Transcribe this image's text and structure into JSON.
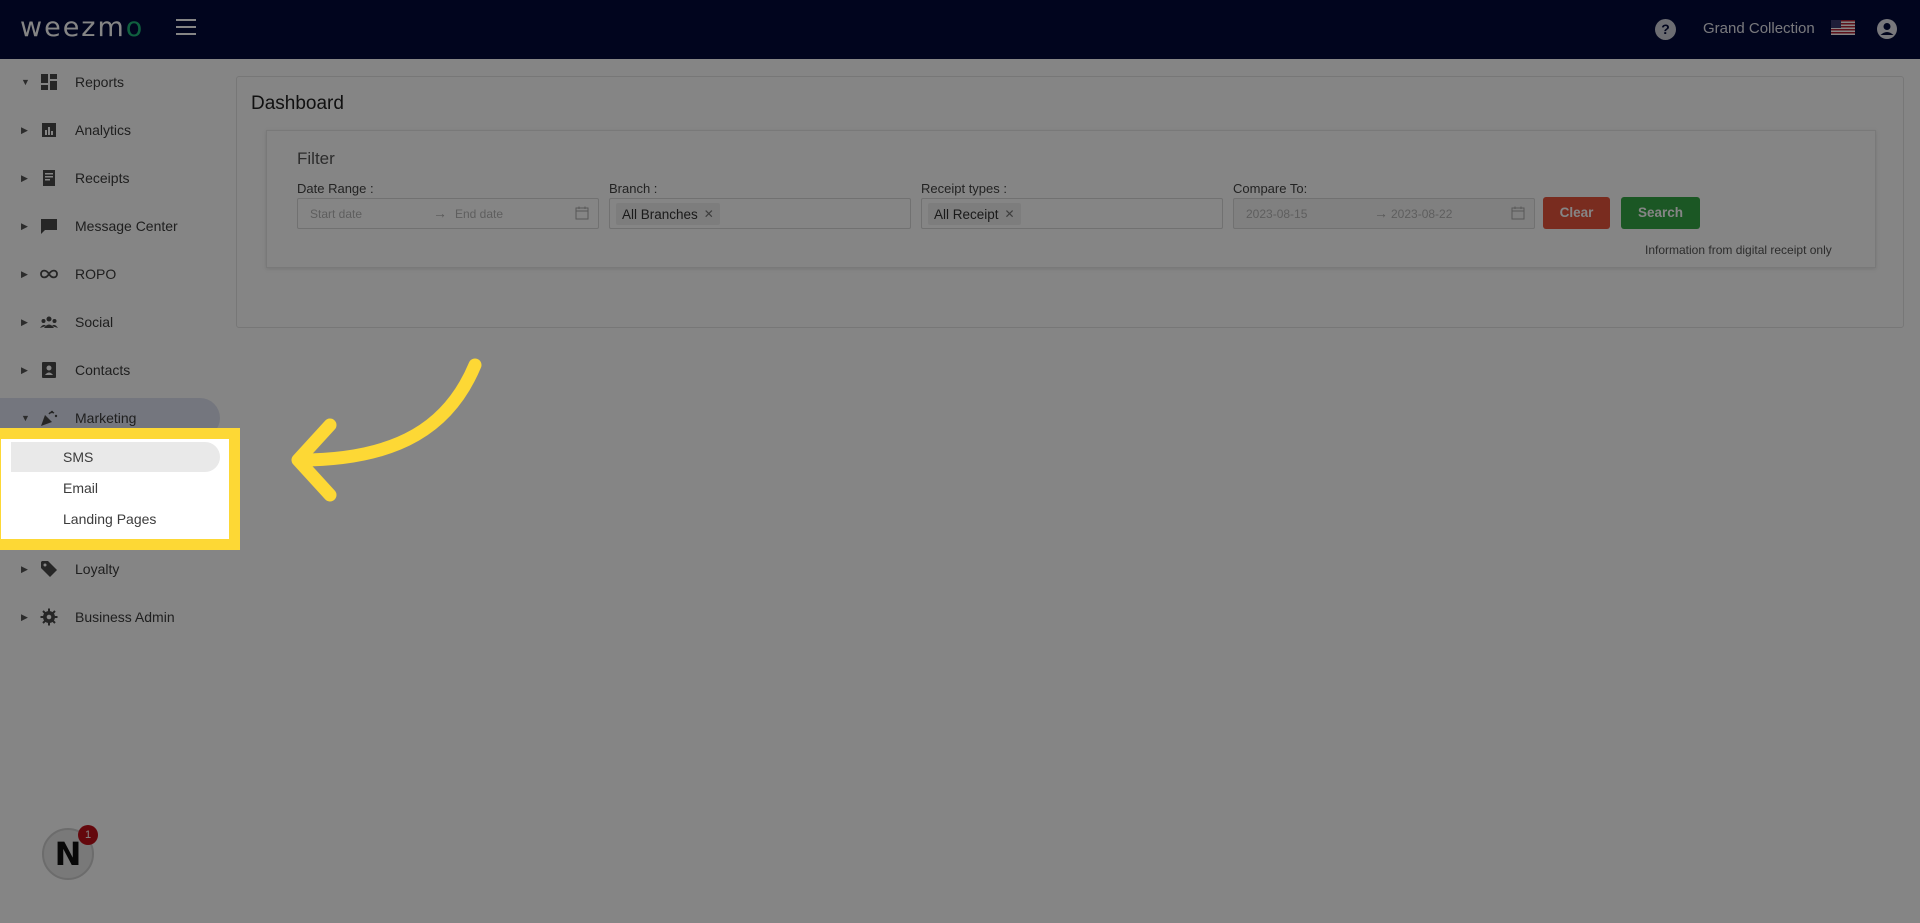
{
  "header": {
    "logo_text": "weezmo",
    "account_name": "Grand Collection",
    "help_label": "?",
    "colors": {
      "bar": "#020b3b",
      "logo_accent": "#1fb879"
    }
  },
  "sidebar": {
    "items": [
      {
        "label": "Reports",
        "icon": "dashboard-icon"
      },
      {
        "label": "Analytics",
        "icon": "analytics-icon"
      },
      {
        "label": "Receipts",
        "icon": "receipt-icon"
      },
      {
        "label": "Message Center",
        "icon": "chat-icon"
      },
      {
        "label": "ROPO",
        "icon": "infinity-icon"
      },
      {
        "label": "Social",
        "icon": "group-icon"
      },
      {
        "label": "Contacts",
        "icon": "contacts-icon"
      },
      {
        "label": "Marketing",
        "icon": "celebration-icon"
      },
      {
        "label": "Loyalty",
        "icon": "tag-icon"
      },
      {
        "label": "Business Admin",
        "icon": "gear-icon"
      }
    ],
    "marketing_subitems": [
      {
        "label": "SMS"
      },
      {
        "label": "Email"
      },
      {
        "label": "Landing Pages"
      }
    ]
  },
  "main": {
    "title": "Dashboard",
    "filter": {
      "title": "Filter",
      "date_range_label": "Date Range :",
      "start_placeholder": "Start date",
      "end_placeholder": "End date",
      "branch_label": "Branch :",
      "branch_value": "All Branches",
      "receipt_types_label": "Receipt types :",
      "receipt_types_value": "All Receipt",
      "compare_label": "Compare To:",
      "compare_start": "2023-08-15",
      "compare_end": "2023-08-22",
      "clear_label": "Clear",
      "search_label": "Search",
      "note": "Information from digital receipt only"
    }
  },
  "badge": {
    "letter": "N",
    "count": "1"
  }
}
